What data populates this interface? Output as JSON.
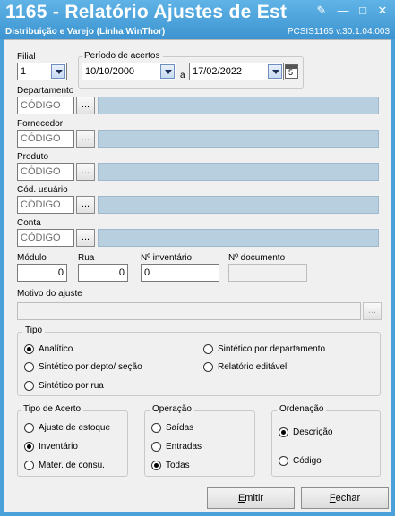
{
  "window": {
    "title": "1165 - Relatório Ajustes de Est",
    "subtitle": "Distribuição e Varejo (Linha WinThor)",
    "version": "PCSIS1165  v.30.1.04.003",
    "pin_glyph": "✎",
    "min_glyph": "—",
    "max_glyph": "□",
    "close_glyph": "✕"
  },
  "filial": {
    "label": "Filial",
    "value": "1"
  },
  "periodo": {
    "label": "Período de acertos",
    "start": "10/10/2000",
    "sep": "a",
    "end": "17/02/2022"
  },
  "lookups": [
    {
      "label": "Departamento",
      "code_placeholder": "CÓDIGO",
      "button": "..."
    },
    {
      "label": "Fornecedor",
      "code_placeholder": "CÓDIGO",
      "button": "..."
    },
    {
      "label": "Produto",
      "code_placeholder": "CÓDIGO",
      "button": "..."
    },
    {
      "label": "Cód. usuário",
      "code_placeholder": "CÓDIGO",
      "button": "..."
    },
    {
      "label": "Conta",
      "code_placeholder": "CÓDIGO",
      "button": "..."
    }
  ],
  "modulo": {
    "label": "Módulo",
    "value": "0"
  },
  "rua": {
    "label": "Rua",
    "value": "0"
  },
  "inventario": {
    "label": "Nº inventário",
    "value": "0"
  },
  "documento": {
    "label": "Nº documento",
    "value": ""
  },
  "motivo": {
    "label": "Motivo do ajuste",
    "value": "",
    "button": "..."
  },
  "tipo": {
    "title": "Tipo",
    "options": [
      {
        "label": "Analítico",
        "selected": true
      },
      {
        "label": "Sintético por depto/ seção",
        "selected": false
      },
      {
        "label": "Sintético por rua",
        "selected": false
      },
      {
        "label": "Sintético por departamento",
        "selected": false
      },
      {
        "label": "Relatório editável",
        "selected": false
      }
    ]
  },
  "tipo_acerto": {
    "title": "Tipo de Acerto",
    "options": [
      {
        "label": "Ajuste de estoque",
        "selected": false
      },
      {
        "label": "Inventário",
        "selected": true
      },
      {
        "label": "Mater. de consu.",
        "selected": false
      }
    ]
  },
  "operacao": {
    "title": "Operação",
    "options": [
      {
        "label": "Saídas",
        "selected": false
      },
      {
        "label": "Entradas",
        "selected": false
      },
      {
        "label": "Todas",
        "selected": true
      }
    ]
  },
  "ordenacao": {
    "title": "Ordenação",
    "options": [
      {
        "label": "Descrição",
        "selected": true
      },
      {
        "label": "Código",
        "selected": false
      }
    ]
  },
  "buttons": {
    "emitir_accel": "E",
    "emitir_rest": "mitir",
    "fechar_accel": "F",
    "fechar_rest": "echar"
  }
}
